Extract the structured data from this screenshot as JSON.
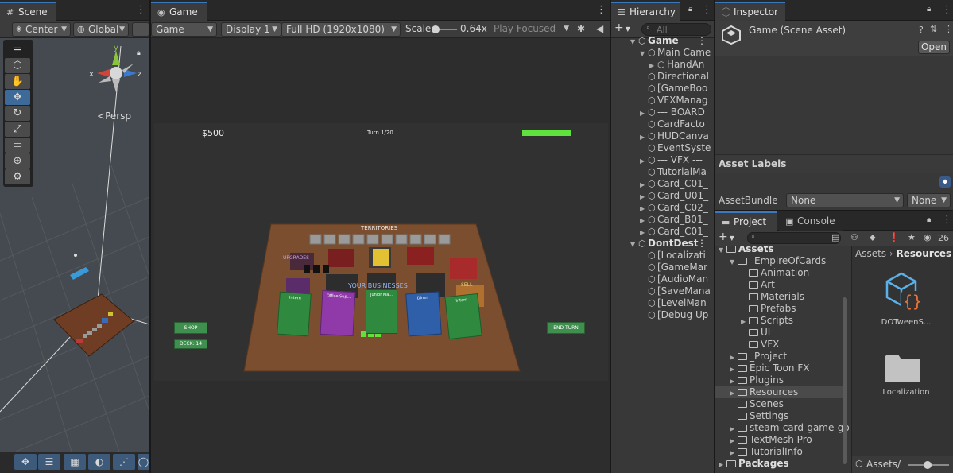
{
  "scene": {
    "tab_title": "Scene",
    "pivot_mode": "Center",
    "pivot_rotation": "Global",
    "persp_label": "Persp",
    "gizmo_axes": {
      "x": "x",
      "y": "y",
      "z": "z"
    }
  },
  "game": {
    "tab_title": "Game",
    "view_mode": "Game",
    "display": "Display 1",
    "resolution": "Full HD (1920x1080)",
    "scale_label": "Scale",
    "scale_value": "0.64x",
    "play_focus": "Play Focused",
    "hud": {
      "money": "$500",
      "turn": "Turn 1/20",
      "shop_button": "SHOP",
      "deck": "DECK: 14",
      "end_turn_button": "END TURN",
      "territories_label": "TERRITORIES",
      "upgrades_label": "UPGRADES",
      "sell_label": "SELL",
      "your_businesses_label": "YOUR BUSINESSES"
    },
    "cards": [
      {
        "title": "Intern",
        "color": "#2f8a3f"
      },
      {
        "title": "Office Sup...",
        "color": "#8f3aa8"
      },
      {
        "title": "Junior Ma...",
        "color": "#2f8a3f"
      },
      {
        "title": "Diner",
        "color": "#2f5fa8"
      },
      {
        "title": "Intern",
        "color": "#2f8a3f"
      }
    ]
  },
  "hierarchy": {
    "tab_title": "Hierarchy",
    "search_placeholder": "All",
    "items": [
      {
        "label": "Game",
        "depth": 0,
        "fold": "open",
        "bold": true
      },
      {
        "label": "Main Came",
        "depth": 1,
        "fold": "open"
      },
      {
        "label": "HandAn",
        "depth": 2,
        "fold": "closed"
      },
      {
        "label": "Directional",
        "depth": 1,
        "fold": ""
      },
      {
        "label": "[GameBoo",
        "depth": 1,
        "fold": ""
      },
      {
        "label": "VFXManag",
        "depth": 1,
        "fold": ""
      },
      {
        "label": "--- BOARD",
        "depth": 1,
        "fold": "closed"
      },
      {
        "label": "CardFacto",
        "depth": 1,
        "fold": ""
      },
      {
        "label": "HUDCanva",
        "depth": 1,
        "fold": "closed"
      },
      {
        "label": "EventSyste",
        "depth": 1,
        "fold": ""
      },
      {
        "label": "--- VFX ---",
        "depth": 1,
        "fold": "closed"
      },
      {
        "label": "TutorialMa",
        "depth": 1,
        "fold": ""
      },
      {
        "label": "Card_C01_",
        "depth": 1,
        "fold": "closed"
      },
      {
        "label": "Card_U01_",
        "depth": 1,
        "fold": "closed"
      },
      {
        "label": "Card_C02_",
        "depth": 1,
        "fold": "closed"
      },
      {
        "label": "Card_B01_",
        "depth": 1,
        "fold": "closed"
      },
      {
        "label": "Card_C01_",
        "depth": 1,
        "fold": "closed"
      },
      {
        "label": "DontDest",
        "depth": 0,
        "fold": "open",
        "bold": true
      },
      {
        "label": "[Localizati",
        "depth": 1,
        "fold": ""
      },
      {
        "label": "[GameMar",
        "depth": 1,
        "fold": ""
      },
      {
        "label": "[AudioMan",
        "depth": 1,
        "fold": ""
      },
      {
        "label": "[SaveMana",
        "depth": 1,
        "fold": ""
      },
      {
        "label": "[LevelMan",
        "depth": 1,
        "fold": ""
      },
      {
        "label": "[Debug Up",
        "depth": 1,
        "fold": ""
      }
    ]
  },
  "inspector": {
    "tab_title": "Inspector",
    "asset_title": "Game (Scene Asset)",
    "open_button": "Open",
    "asset_labels": "Asset Labels",
    "asset_bundle_label": "AssetBundle",
    "asset_bundle_value": "None",
    "asset_variant_value": "None"
  },
  "project": {
    "tab_project": "Project",
    "tab_console": "Console",
    "hidden_count": "26",
    "breadcrumb_root": "Assets",
    "breadcrumb_sep": "›",
    "breadcrumb_current": "Resources",
    "footer_path": "Assets/",
    "tree": [
      {
        "label": "Assets",
        "depth": 0,
        "fold": "open",
        "bold": true
      },
      {
        "label": "_EmpireOfCards",
        "depth": 1,
        "fold": "open"
      },
      {
        "label": "Animation",
        "depth": 2,
        "fold": ""
      },
      {
        "label": "Art",
        "depth": 2,
        "fold": ""
      },
      {
        "label": "Materials",
        "depth": 2,
        "fold": ""
      },
      {
        "label": "Prefabs",
        "depth": 2,
        "fold": ""
      },
      {
        "label": "Scripts",
        "depth": 2,
        "fold": "closed"
      },
      {
        "label": "UI",
        "depth": 2,
        "fold": ""
      },
      {
        "label": "VFX",
        "depth": 2,
        "fold": ""
      },
      {
        "label": "_Project",
        "depth": 1,
        "fold": "closed"
      },
      {
        "label": "Epic Toon FX",
        "depth": 1,
        "fold": "closed"
      },
      {
        "label": "Plugins",
        "depth": 1,
        "fold": "closed"
      },
      {
        "label": "Resources",
        "depth": 1,
        "fold": "closed",
        "selected": true
      },
      {
        "label": "Scenes",
        "depth": 1,
        "fold": ""
      },
      {
        "label": "Settings",
        "depth": 1,
        "fold": ""
      },
      {
        "label": "steam-card-game-go",
        "depth": 1,
        "fold": "closed"
      },
      {
        "label": "TextMesh Pro",
        "depth": 1,
        "fold": "closed"
      },
      {
        "label": "TutorialInfo",
        "depth": 1,
        "fold": "closed"
      },
      {
        "label": "Packages",
        "depth": 0,
        "fold": "closed",
        "bold": true
      }
    ],
    "assets": [
      {
        "label": "DOTweenS...",
        "icon": "script-asset-icon"
      },
      {
        "label": "Localization",
        "icon": "folder-icon"
      }
    ]
  },
  "colors": {
    "accent": "#3a79bb",
    "hud_bar": "#5fe23d",
    "button_green": "#3f8f4f",
    "board": "#7a4e2e"
  }
}
